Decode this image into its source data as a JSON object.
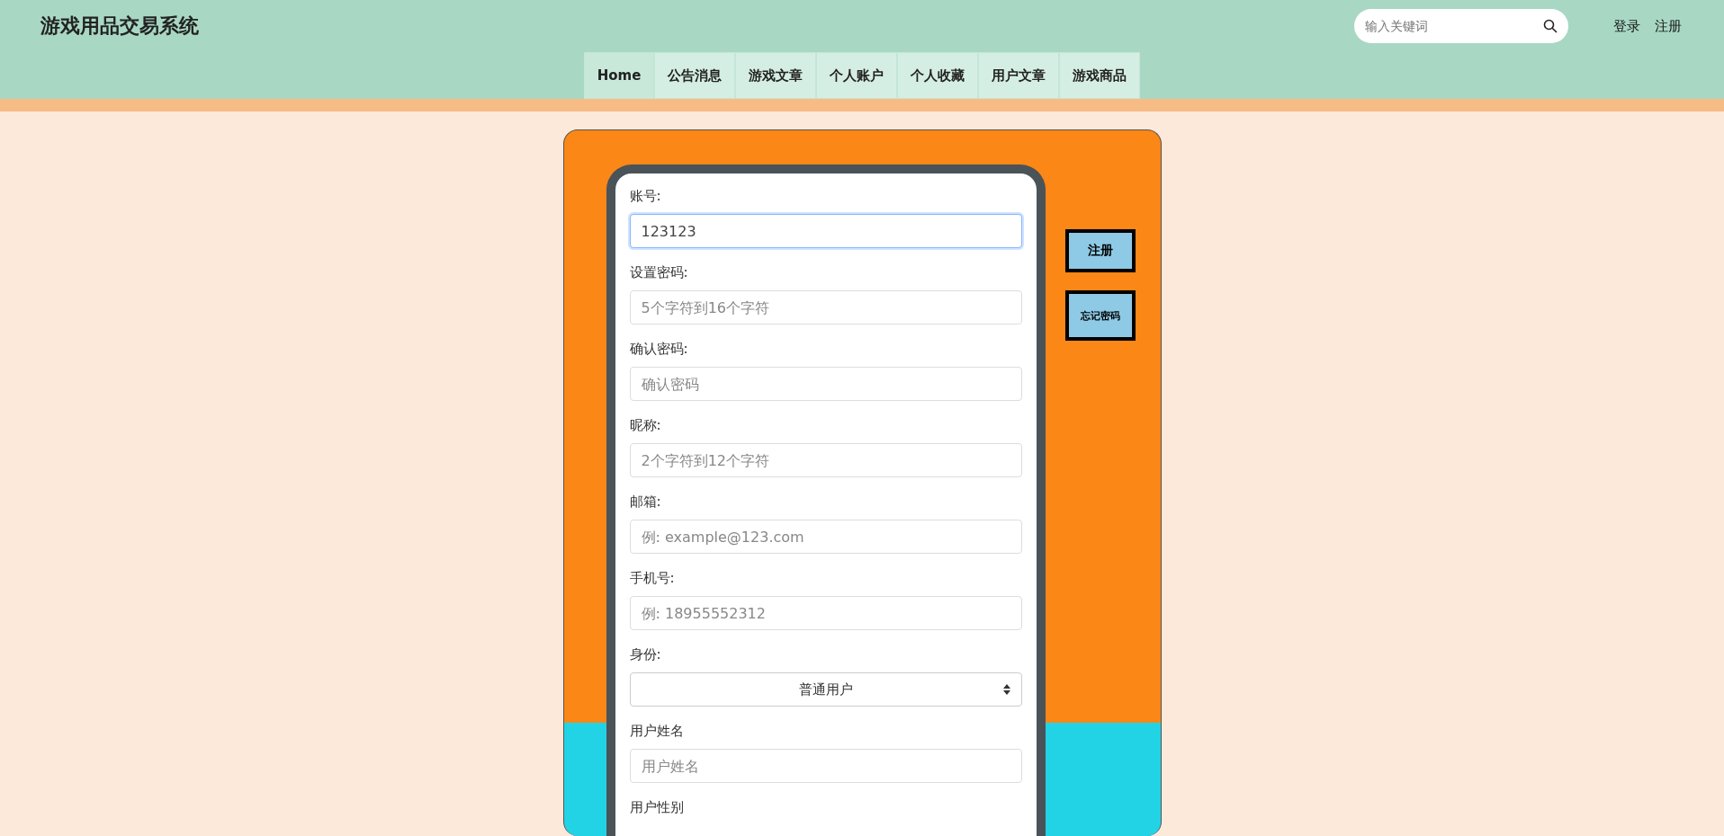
{
  "header": {
    "title": "游戏用品交易系统",
    "search": {
      "placeholder": "输入关键词"
    },
    "links": [
      "登录",
      "注册"
    ]
  },
  "nav": [
    {
      "label": "Home",
      "selected": true
    },
    {
      "label": "公告消息",
      "selected": false
    },
    {
      "label": "游戏文章",
      "selected": false
    },
    {
      "label": "个人账户",
      "selected": false
    },
    {
      "label": "个人收藏",
      "selected": false
    },
    {
      "label": "用户文章",
      "selected": false
    },
    {
      "label": "游戏商品",
      "selected": false
    }
  ],
  "form": {
    "fields": [
      {
        "kind": "input",
        "label": "账号:",
        "value": "123123",
        "focused": true
      },
      {
        "kind": "input",
        "label": "设置密码:",
        "placeholder": "5个字符到16个字符",
        "focused": false
      },
      {
        "kind": "input",
        "label": "确认密码:",
        "placeholder": "确认密码",
        "focused": false
      },
      {
        "kind": "input",
        "label": "昵称:",
        "placeholder": "2个字符到12个字符",
        "focused": false
      },
      {
        "kind": "input",
        "label": "邮箱:",
        "placeholder": "例: example@123.com",
        "focused": false
      },
      {
        "kind": "input",
        "label": "手机号:",
        "placeholder": "例: 18955552312",
        "focused": false
      },
      {
        "kind": "select",
        "label": "身份:",
        "value": "普通用户"
      },
      {
        "kind": "input",
        "label": "用户姓名",
        "placeholder": "用户姓名",
        "focused": false
      },
      {
        "kind": "label",
        "label": "用户性别"
      }
    ]
  },
  "side_buttons": [
    {
      "label": "注册",
      "kind": "large"
    },
    {
      "label": "忘记密码",
      "kind": "small"
    }
  ]
}
